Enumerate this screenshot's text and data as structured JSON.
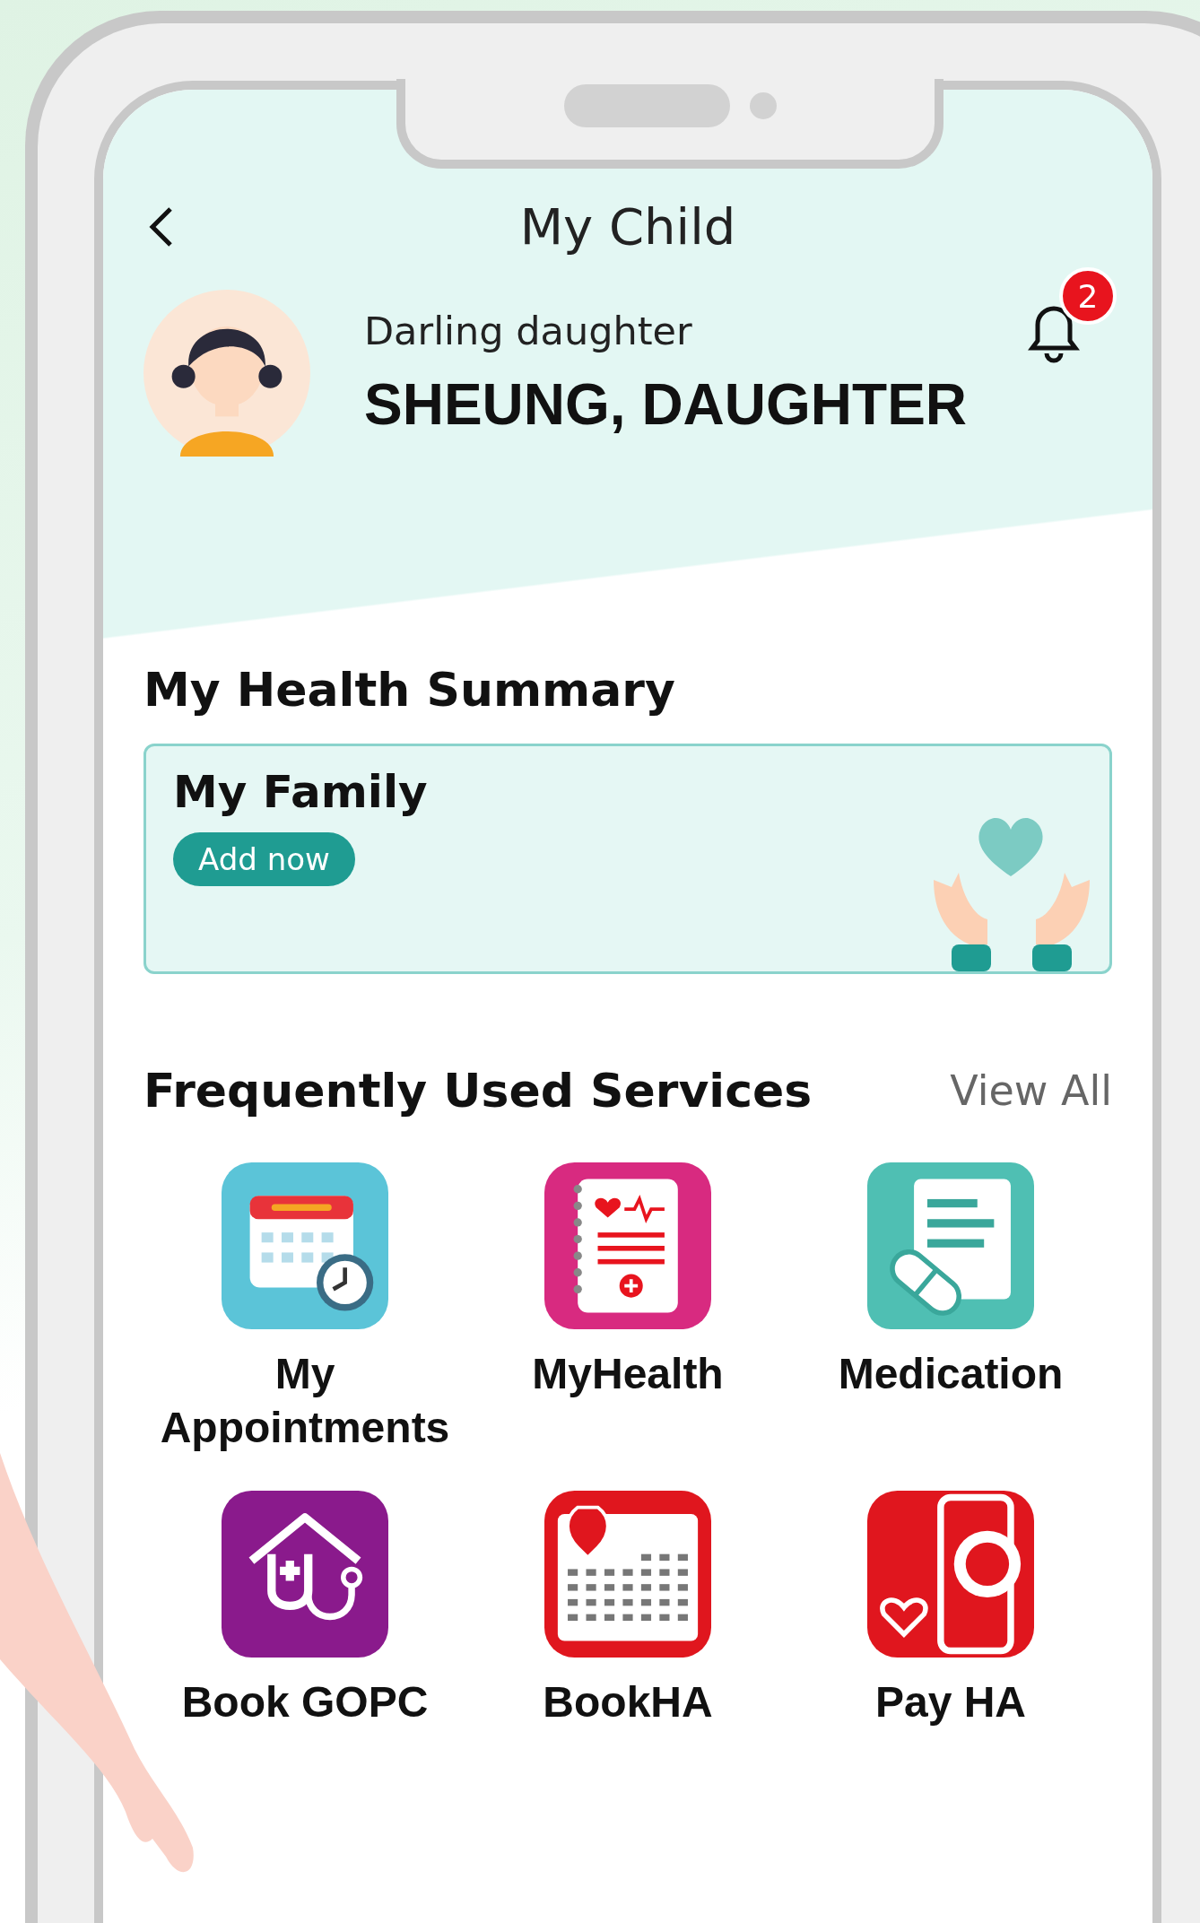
{
  "header": {
    "title": "My Child"
  },
  "profile": {
    "relation": "Darling daughter",
    "name": "SHEUNG, DAUGHTER"
  },
  "notifications": {
    "count": "2"
  },
  "health_summary": {
    "title": "My Health Summary",
    "card": {
      "title": "My Family",
      "button": "Add now"
    }
  },
  "services": {
    "title": "Frequently Used Services",
    "view_all": "View All",
    "items": [
      {
        "label": "My Appointments",
        "kind": "appointments"
      },
      {
        "label": "MyHealth",
        "kind": "health"
      },
      {
        "label": "Medication",
        "kind": "medication"
      },
      {
        "label": "Book GOPC",
        "kind": "gopc"
      },
      {
        "label": "BookHA",
        "kind": "bookha"
      },
      {
        "label": "Pay HA",
        "kind": "pay"
      }
    ]
  }
}
